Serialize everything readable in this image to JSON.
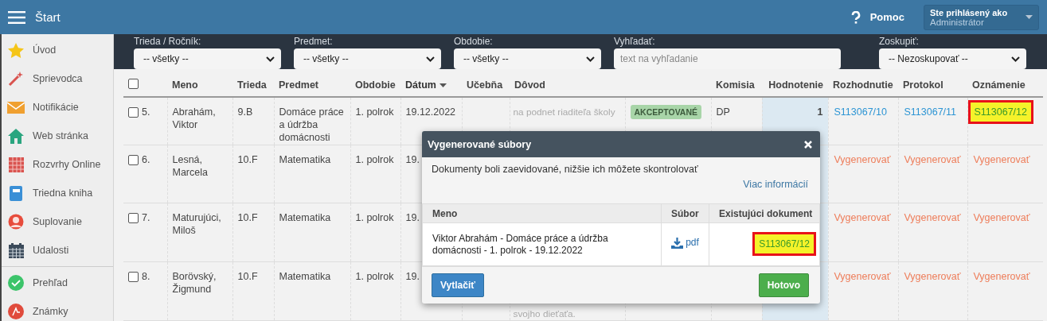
{
  "header": {
    "title": "Štart",
    "help": "Pomoc",
    "user": {
      "label": "Ste prihlásený ako",
      "name": "Administrátor"
    }
  },
  "sidebar": {
    "groups": [
      [
        {
          "label": "Úvod"
        },
        {
          "label": "Sprievodca"
        },
        {
          "label": "Notifikácie"
        },
        {
          "label": "Web stránka"
        },
        {
          "label": "Rozvrhy Online"
        },
        {
          "label": "Triedna kniha"
        },
        {
          "label": "Suplovanie"
        },
        {
          "label": "Udalosti"
        }
      ],
      [
        {
          "label": "Prehľad"
        },
        {
          "label": "Známky"
        }
      ]
    ]
  },
  "filters": [
    {
      "label": "Trieda / Ročník:",
      "kind": "select",
      "value": "-- všetky --"
    },
    {
      "label": "Predmet:",
      "kind": "select",
      "value": "-- všetky --"
    },
    {
      "label": "Obdobie:",
      "kind": "select",
      "value": "-- všetky --"
    },
    {
      "label": "Vyhľadať:",
      "kind": "text",
      "placeholder": "text na vyhľadanie"
    },
    {
      "label": "Zoskupiť:",
      "kind": "select",
      "value": "-- Nezoskupovať --"
    }
  ],
  "table": {
    "select_all": {
      "checked": false
    },
    "columns": [
      {
        "label": "Meno",
        "sorted": false
      },
      {
        "label": "Trieda",
        "sorted": false
      },
      {
        "label": "Predmet",
        "sorted": false
      },
      {
        "label": "Obdobie",
        "sorted": false
      },
      {
        "label": "Dátum",
        "sorted": true
      },
      {
        "label": "Učebňa",
        "sorted": false
      },
      {
        "label": "Dôvod",
        "sorted": false
      },
      {
        "sorted": false
      },
      {
        "label": "Komisia",
        "sorted": false
      },
      {
        "label": "Hodnotenie",
        "sorted": false
      },
      {
        "label": "Rozhodnutie",
        "sorted": false
      },
      {
        "label": "Protokol",
        "sorted": false
      },
      {
        "label": "Oznámenie",
        "sorted": false
      }
    ],
    "rows": [
      {
        "number": "5.",
        "checked": false,
        "name": "Abrahám, Viktor",
        "class": "9.B",
        "subject": "Domáce práce a údržba domácnosti",
        "period": "1. polrok",
        "date": "19.12.2022",
        "reason": "na podnet riaditeľa školy",
        "status": "AKCEPTOVANÉ",
        "commission": "DP",
        "grade": "1",
        "docs": [
          {
            "text": "S113067/10",
            "kind": "document",
            "highlighted": false
          },
          {
            "text": "S113067/11",
            "kind": "document",
            "highlighted": false
          },
          {
            "text": "S113067/12",
            "kind": "document",
            "highlighted": true
          }
        ]
      },
      {
        "number": "6.",
        "checked": false,
        "name": "Lesná, Marcela",
        "class": "10.F",
        "subject": "Matematika",
        "period": "1. polrok",
        "date": "19.",
        "docs": [
          {
            "text": "Vygenerovať",
            "kind": "generate",
            "highlighted": false
          },
          {
            "text": "Vygenerovať",
            "kind": "generate",
            "highlighted": false
          },
          {
            "text": "Vygenerovať",
            "kind": "generate",
            "highlighted": false
          }
        ]
      },
      {
        "number": "7.",
        "checked": false,
        "name": "Maturujúci, Miloš",
        "class": "10.F",
        "subject": "Matematika",
        "period": "1. polrok",
        "date": "19.",
        "docs": [
          {
            "text": "Vygenerovať",
            "kind": "generate",
            "highlighted": false
          },
          {
            "text": "Vygenerovať",
            "kind": "generate",
            "highlighted": false
          },
          {
            "text": "Vygenerovať",
            "kind": "generate",
            "highlighted": false
          }
        ]
      },
      {
        "number": "8.",
        "checked": false,
        "name": "Borövský, Žigmund",
        "class": "10.F",
        "subject": "Matematika",
        "period": "1. polrok",
        "date": "19.",
        "reason_tail": "svojho dieťaťa.",
        "docs": [
          {
            "text": "Vygenerovať",
            "kind": "generate",
            "highlighted": false
          },
          {
            "text": "Vygenerovať",
            "kind": "generate",
            "highlighted": false
          },
          {
            "text": "Vygenerovať",
            "kind": "generate",
            "highlighted": false
          }
        ]
      }
    ]
  },
  "dialog": {
    "title": "Vygenerované súbory",
    "message": "Dokumenty boli zaevidované, nižšie ich môžete skontrolovať",
    "more_link": "Viac informácií",
    "columns": [
      "Meno",
      "Súbor",
      "Existujúci dokument"
    ],
    "rows": [
      {
        "name": "Viktor Abrahám - Domáce práce a údržba domácnosti - 1. polrok - 19.12.2022",
        "file": "pdf",
        "document": "S113067/12",
        "highlighted": true
      }
    ],
    "buttons": [
      {
        "label": "Vytlačiť",
        "kind": "primary"
      },
      {
        "label": "Hotovo",
        "kind": "success"
      }
    ]
  }
}
